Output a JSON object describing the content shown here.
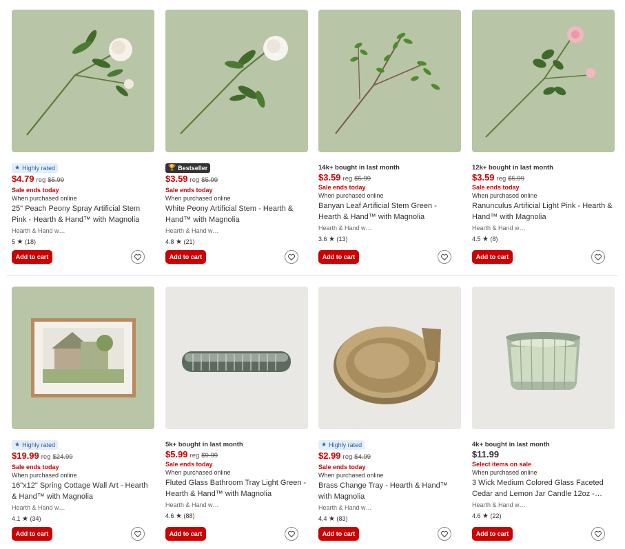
{
  "products": [
    {
      "badge_type": "highly_rated",
      "badge": "Highly rated",
      "price": "$4.79",
      "reg_label": "reg",
      "reg_price": "$5.99",
      "sale_text": "Sale ends today",
      "when_text": "When purchased online",
      "title": "25\" Peach Peony Spray Artificial Stem Pink - Hearth & Hand™ with Magnolia",
      "brand": "Hearth & Hand w…",
      "rating": "5",
      "reviews": "(18)",
      "cart_label": "Add to cart",
      "image": "white-peony-stem"
    },
    {
      "badge_type": "bestseller",
      "badge": "Bestseller",
      "price": "$3.59",
      "reg_label": "reg",
      "reg_price": "$5.99",
      "sale_text": "Sale ends today",
      "when_text": "When purchased online",
      "title": "White Peony Artificial Stem - Hearth & Hand™ with Magnolia",
      "brand": "Hearth & Hand w…",
      "rating": "4.8",
      "reviews": "(21)",
      "cart_label": "Add to cart",
      "image": "white-peony-stem"
    },
    {
      "badge_type": "bought",
      "badge": "14k+ bought in last month",
      "price": "$3.59",
      "reg_label": "reg",
      "reg_price": "$5.99",
      "sale_text": "Sale ends today",
      "when_text": "When purchased online",
      "title": "Banyan Leaf Artificial Stem Green - Hearth & Hand™ with Magnolia",
      "brand": "Hearth & Hand w…",
      "rating": "3.6",
      "reviews": "(13)",
      "cart_label": "Add to cart",
      "image": "banyan-leaf-stem"
    },
    {
      "badge_type": "bought",
      "badge": "12k+ bought in last month",
      "price": "$3.59",
      "reg_label": "reg",
      "reg_price": "$5.99",
      "sale_text": "Sale ends today",
      "when_text": "When purchased online",
      "title": "Ranunculus Artificial Light Pink - Hearth & Hand™ with Magnolia",
      "brand": "Hearth & Hand w…",
      "rating": "4.5",
      "reviews": "(8)",
      "cart_label": "Add to cart",
      "image": "pink-ranunculus-stem"
    },
    {
      "badge_type": "highly_rated",
      "badge": "Highly rated",
      "price": "$19.99",
      "reg_label": "reg",
      "reg_price": "$24.99",
      "sale_text": "Sale ends today",
      "when_text": "When purchased online",
      "title": "16\"x12\" Spring Cottage Wall Art - Hearth & Hand™ with Magnolia",
      "brand": "Hearth & Hand w…",
      "rating": "4.1",
      "reviews": "(34)",
      "cart_label": "Add to cart",
      "image": "framed-cottage-art"
    },
    {
      "badge_type": "bought",
      "badge": "5k+ bought in last month",
      "price": "$5.99",
      "reg_label": "reg",
      "reg_price": "$9.99",
      "sale_text": "Sale ends today",
      "when_text": "When purchased online",
      "title": "Fluted Glass Bathroom Tray Light Green - Hearth & Hand™ with Magnolia",
      "brand": "Hearth & Hand w…",
      "rating": "4.6",
      "reviews": "(88)",
      "cart_label": "Add to cart",
      "image": "fluted-glass-tray"
    },
    {
      "badge_type": "highly_rated",
      "badge": "Highly rated",
      "price": "$2.99",
      "reg_label": "reg",
      "reg_price": "$4.99",
      "sale_text": "Sale ends today",
      "when_text": "When purchased online",
      "title": "Brass Change Tray - Hearth & Hand™ with Magnolia",
      "brand": "Hearth & Hand w…",
      "rating": "4.4",
      "reviews": "(83)",
      "cart_label": "Add to cart",
      "image": "brass-change-tray"
    },
    {
      "badge_type": "bought",
      "badge": "4k+ bought in last month",
      "price": "$11.99",
      "reg_label": "",
      "reg_price": "",
      "sale_text": "Select items on sale",
      "when_text": "When purchased online",
      "title": "3 Wick Medium Colored Glass Faceted Cedar and Lemon Jar Candle 12oz -…",
      "brand": "Hearth & Hand w…",
      "rating": "4.6",
      "reviews": "(22)",
      "cart_label": "Add to cart",
      "image": "green-glass-candle"
    }
  ],
  "colors": {
    "sale_red": "#cc0000",
    "sage_bg": "#b9c6a8",
    "gray_bg": "#e9e8e5"
  }
}
